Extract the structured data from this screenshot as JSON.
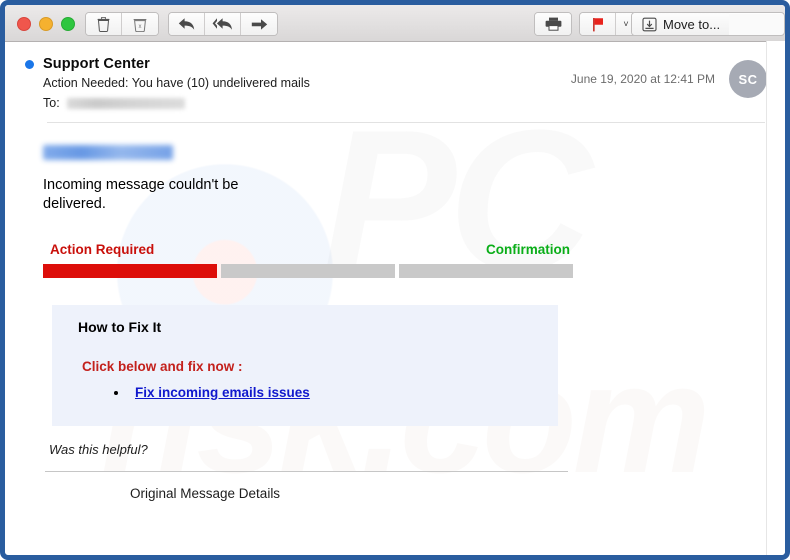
{
  "window": {
    "border_color": "#2a5d9f"
  },
  "toolbar": {
    "traffic_lights": [
      "close",
      "minimize",
      "zoom"
    ],
    "delete_label": "Delete",
    "archive_label": "Archive",
    "reply_label": "Reply",
    "reply_all_label": "Reply All",
    "forward_label": "Forward",
    "print_label": "Print",
    "flag_label": "Flag",
    "flag_caret_label": "˅",
    "move_label": "Move to...",
    "flag_color": "#e8231c"
  },
  "message": {
    "sender": "Support Center",
    "subject": "Action Needed: You have (10) undelivered mails",
    "to_label": "To:",
    "to_value_redacted": true,
    "date": "June 19, 2020 at 12:41 PM",
    "avatar_initials": "SC",
    "unread": true
  },
  "body": {
    "sender_address_redacted": true,
    "notice": "Incoming message  couldn't be delivered."
  },
  "stages": {
    "action_label": "Action Required",
    "action_color": "#c9100b",
    "confirmation_label": "Confirmation",
    "confirmation_color": "#0aae18",
    "bars": [
      {
        "name": "action-required",
        "fill": "#dd0e0a",
        "active": true
      },
      {
        "name": "in-progress",
        "fill": "#c9c9c9",
        "active": false
      },
      {
        "name": "confirmation",
        "fill": "#c9c9c9",
        "active": false
      }
    ]
  },
  "fixbox": {
    "background": "#eef2fb",
    "title": "How to Fix It",
    "cta": "Click below and fix now :",
    "link_text": " Fix incoming emails issues",
    "link_color": "#1018cd"
  },
  "footer": {
    "helpful": "Was this helpful?",
    "original_message_details": "Original Message Details"
  },
  "watermark": {
    "top_text": "PC",
    "bottom_text": "risk.com"
  }
}
